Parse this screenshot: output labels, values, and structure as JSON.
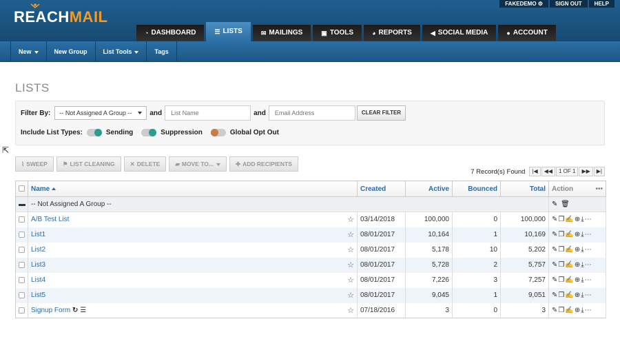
{
  "brand": {
    "logo_part1": "REACH",
    "logo_part2": "MAIL"
  },
  "topbar": {
    "account": "FAKEDEMO",
    "sign_out": "SIGN OUT",
    "help": "HELP"
  },
  "mainnav": [
    {
      "label": "DASHBOARD",
      "icon": "dashboard-icon"
    },
    {
      "label": "LISTS",
      "icon": "list-icon",
      "active": true
    },
    {
      "label": "MAILINGS",
      "icon": "envelope-icon"
    },
    {
      "label": "TOOLS",
      "icon": "toolbox-icon"
    },
    {
      "label": "REPORTS",
      "icon": "pie-chart-icon"
    },
    {
      "label": "SOCIAL MEDIA",
      "icon": "megaphone-icon"
    },
    {
      "label": "ACCOUNT",
      "icon": "user-icon"
    }
  ],
  "subnav": {
    "new": "New",
    "new_group": "New Group",
    "list_tools": "List Tools",
    "tags": "Tags"
  },
  "page": {
    "title": "LISTS"
  },
  "filter": {
    "label": "Filter By:",
    "group_select": "-- Not Assigned A Group --",
    "and1": "and",
    "name_placeholder": "List Name",
    "and2": "and",
    "email_placeholder": "Email Address",
    "clear": "CLEAR FILTER",
    "types_label": "Include List Types:",
    "types": [
      {
        "label": "Sending",
        "on": true
      },
      {
        "label": "Suppression",
        "on": true
      },
      {
        "label": "Global Opt Out",
        "on": false
      }
    ]
  },
  "actions": {
    "sweep": "SWEEP",
    "list_cleaning": "LIST CLEANING",
    "delete": "DELETE",
    "move_to": "MOVE TO...",
    "add_recipients": "ADD RECIPIENTS"
  },
  "records": {
    "count": "7 Record(s) Found",
    "page": "1 OF 1"
  },
  "table": {
    "headers": {
      "name": "Name",
      "created": "Created",
      "active": "Active",
      "bounced": "Bounced",
      "total": "Total",
      "action": "Action"
    },
    "group_row": "-- Not Assigned A Group --",
    "rows": [
      {
        "name": "A/B Test List",
        "created": "03/14/2018",
        "active": "100,000",
        "bounced": "0",
        "total": "100,000"
      },
      {
        "name": "List1",
        "created": "08/01/2017",
        "active": "10,164",
        "bounced": "1",
        "total": "10,169"
      },
      {
        "name": "List2",
        "created": "08/01/2017",
        "active": "5,178",
        "bounced": "10",
        "total": "5,202"
      },
      {
        "name": "List3",
        "created": "08/01/2017",
        "active": "5,728",
        "bounced": "2",
        "total": "5,757"
      },
      {
        "name": "List4",
        "created": "08/01/2017",
        "active": "7,226",
        "bounced": "3",
        "total": "7,257"
      },
      {
        "name": "List5",
        "created": "08/01/2017",
        "active": "9,045",
        "bounced": "1",
        "total": "9,051"
      },
      {
        "name": "Signup Form",
        "created": "07/18/2016",
        "active": "3",
        "bounced": "0",
        "total": "3"
      }
    ]
  }
}
